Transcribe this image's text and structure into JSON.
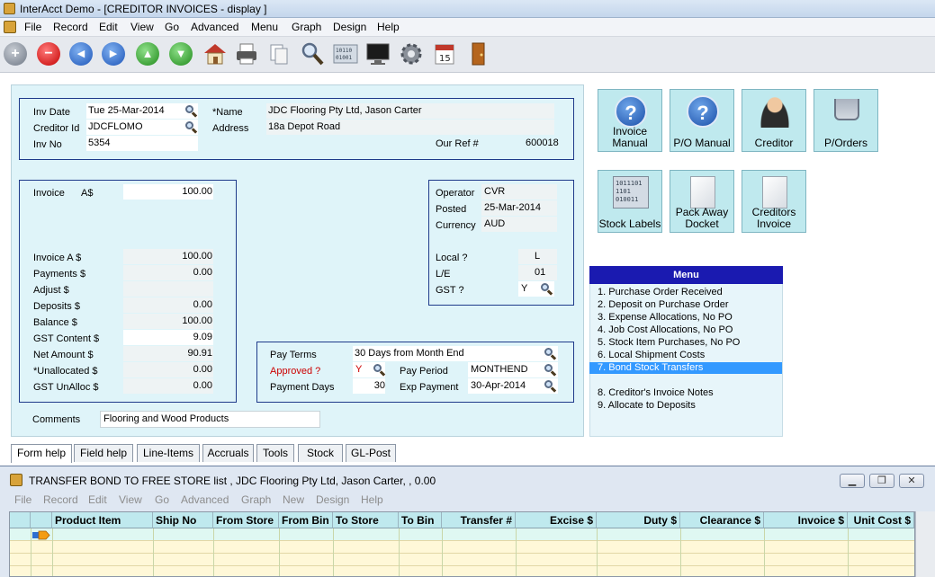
{
  "window": {
    "title": "InterAcct Demo - [CREDITOR INVOICES - display ]"
  },
  "menubar": {
    "items": [
      "File",
      "Record",
      "Edit",
      "View",
      "Go",
      "Advanced",
      "Menu",
      "Graph",
      "Design",
      "Help"
    ]
  },
  "toolbar": {
    "icons": [
      "add-icon",
      "delete-icon",
      "previous-icon",
      "next-icon",
      "up-icon",
      "down-icon",
      "home-icon",
      "print-icon",
      "copy-icon",
      "search-icon",
      "binary-icon",
      "monitor-icon",
      "settings-icon",
      "calendar-icon",
      "exit-door-icon"
    ],
    "calendar_day": "15"
  },
  "header": {
    "inv_date_label": "Inv Date",
    "inv_date": "Tue 25-Mar-2014",
    "creditor_id_label": "Creditor Id",
    "creditor_id": "JDCFLOMO",
    "inv_no_label": "Inv No",
    "inv_no": "5354",
    "name_label": "*Name",
    "name": "JDC Flooring Pty Ltd, Jason Carter",
    "address_label": "Address",
    "address": "18a Depot Road",
    "our_ref_label": "Our Ref #",
    "our_ref": "600018"
  },
  "amounts": {
    "invoice_label": "Invoice",
    "currency_label": "A$",
    "invoice_input": "100.00",
    "invoice_a_label": "Invoice   A $",
    "invoice_a": "100.00",
    "payments_label": "Payments  $",
    "payments": "0.00",
    "adjust_label": "Adjust $",
    "deposits_label": "Deposits $",
    "deposits": "0.00",
    "balance_label": "Balance    $",
    "balance": "100.00",
    "gst_content_label": "GST Content $",
    "gst_content": "9.09",
    "net_amount_label": "Net Amount  $",
    "net_amount": "90.91",
    "unallocated_label": "*Unallocated $",
    "unallocated": "0.00",
    "gst_unalloc_label": "GST UnAlloc  $",
    "gst_unalloc": "0.00"
  },
  "operator": {
    "operator_label": "Operator",
    "operator": "CVR",
    "posted_label": "Posted",
    "posted": "25-Mar-2014",
    "currency_label": "Currency",
    "currency": "AUD",
    "local_label": "Local ?",
    "local": "L",
    "le_label": "L/E",
    "le": "01",
    "gst_label": "GST ?",
    "gst": "Y"
  },
  "payment": {
    "pay_terms_label": "Pay Terms",
    "pay_terms": "30 Days from Month End",
    "approved_label": "Approved ?",
    "approved": "Y",
    "pay_period_label": "Pay Period",
    "pay_period": "MONTHEND",
    "payment_days_label": "Payment Days",
    "payment_days": "30",
    "exp_payment_label": "Exp Payment",
    "exp_payment": "30-Apr-2014"
  },
  "comments": {
    "label": "Comments",
    "value": "Flooring and Wood Products"
  },
  "big_buttons": [
    {
      "line1": "Invoice",
      "line2": "Manual"
    },
    {
      "line1": "P/O Manual",
      "line2": ""
    },
    {
      "line1": "Creditor",
      "line2": ""
    },
    {
      "line1": "P/Orders",
      "line2": ""
    },
    {
      "line1": "Stock Labels",
      "line2": ""
    },
    {
      "line1": "Pack Away",
      "line2": "Docket"
    },
    {
      "line1": "Creditors",
      "line2": "Invoice"
    }
  ],
  "chip_text": {
    "l1": "1011101",
    "l2": "1101",
    "l3": "010011"
  },
  "menu_panel": {
    "title": "Menu",
    "items": [
      "1. Purchase Order Received",
      "2. Deposit on Purchase Order",
      "3. Expense Allocations,  No PO",
      "4. Job Cost Allocations, No PO",
      "5. Stock Item Purchases, No PO",
      "6. Local Shipment Costs",
      "7. Bond Stock Transfers",
      "8. Creditor's Invoice Notes",
      "9. Allocate to Deposits"
    ]
  },
  "tabs": [
    "Form help",
    "Field help",
    "Line-Items",
    "Accruals",
    "Tools",
    "Stock",
    "GL-Post"
  ],
  "subwindow": {
    "title": "TRANSFER BOND TO FREE STORE list , JDC Flooring Pty Ltd, Jason Carter, , 0.00",
    "menu": [
      "File",
      "Record",
      "Edit",
      "View",
      "Go",
      "Advanced",
      "Graph",
      "New",
      "Design",
      "Help"
    ],
    "columns": [
      "Product Item",
      "Ship No",
      "From Store",
      "From Bin",
      "To Store",
      "To Bin",
      "Transfer #",
      "Excise $",
      "Duty $",
      "Clearance $",
      "Invoice $",
      "Unit Cost $"
    ],
    "window_buttons": [
      "minimize",
      "restore",
      "close"
    ]
  },
  "colors": {
    "form_bg": "#dff4f9",
    "menu_header": "#1a1ab0",
    "selection": "#3399ff",
    "group_border": "#1e3a8a",
    "approved_red": "#cc0000",
    "button_bg": "#bfe9ee"
  }
}
